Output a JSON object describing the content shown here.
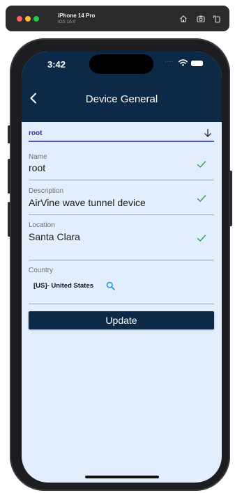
{
  "simulator": {
    "device_name": "iPhone 14 Pro",
    "os_version": "iOS 16.0",
    "icons": [
      "home-icon",
      "screenshot-icon",
      "rotate-icon"
    ]
  },
  "status_bar": {
    "time": "3:42",
    "icons": [
      "wifi-icon",
      "battery-icon"
    ]
  },
  "header": {
    "title": "Device General",
    "back_icon": "chevron-left-icon"
  },
  "search": {
    "value": "root",
    "icon": "arrow-down-icon"
  },
  "fields": [
    {
      "label": "Name",
      "value": "root",
      "status_icon": "check-icon"
    },
    {
      "label": "Description",
      "value": "AirVine wave tunnel device",
      "status_icon": "check-icon"
    },
    {
      "label": "Location",
      "value": "Santa Clara",
      "status_icon": "check-icon"
    }
  ],
  "country": {
    "label": "Country",
    "value": "[US]- United States",
    "icon": "search-icon"
  },
  "actions": {
    "update_label": "Update"
  },
  "colors": {
    "header_bg": "#0c2a47",
    "screen_bg": "#e2eefb",
    "accent_blue": "#27359b",
    "check_green": "#2e9e4b",
    "search_icon_blue": "#1e9be8"
  }
}
